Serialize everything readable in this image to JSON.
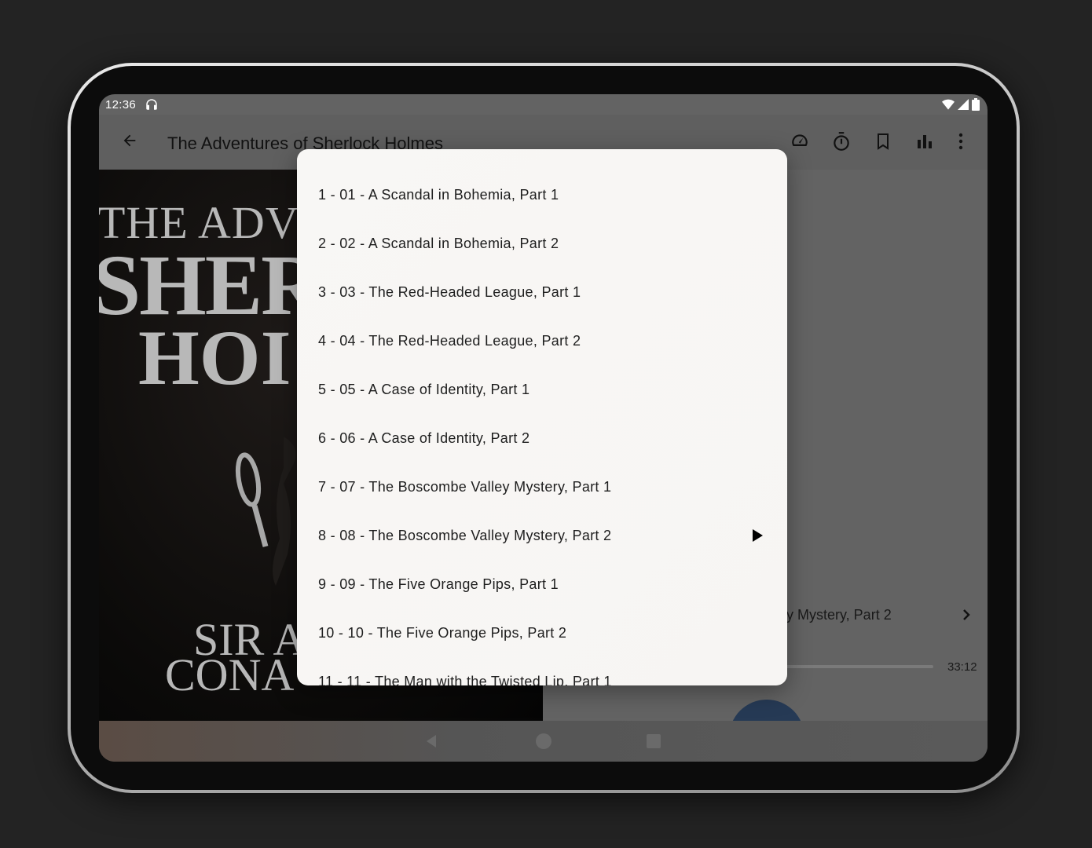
{
  "status_bar": {
    "time": "12:36",
    "left_icons": [
      "headphones-icon"
    ],
    "right_icons": [
      "wifi-icon",
      "signal-icon",
      "battery-icon"
    ]
  },
  "app_bar": {
    "title": "The Adventures of Sherlock Holmes",
    "back_icon": "arrow-back-icon",
    "actions": [
      "playback-speed-icon",
      "sleep-timer-icon",
      "bookmark-icon",
      "equalizer-icon",
      "more-options-icon"
    ]
  },
  "cover": {
    "lines": [
      "THE ADVE",
      "SHER",
      "HOI",
      "SIR A",
      "CONA"
    ]
  },
  "player": {
    "chapter_partial": "ey Mystery, Part 2",
    "total_time": "33:12"
  },
  "chapters_dialog": {
    "current_index": 7,
    "items": [
      "1 - 01 - A Scandal in Bohemia, Part 1",
      "2 - 02 - A Scandal in Bohemia, Part 2",
      "3 - 03 - The Red-Headed League, Part 1",
      "4 - 04 - The Red-Headed League, Part 2",
      "5 - 05 - A Case of Identity, Part 1",
      "6 - 06 - A Case of Identity, Part 2",
      "7 - 07 - The Boscombe Valley Mystery, Part 1",
      "8 - 08 - The Boscombe Valley Mystery, Part 2",
      "9 - 09 - The Five Orange Pips, Part 1",
      "10 - 10 - The Five Orange Pips, Part 2",
      "11 - 11 - The Man with the Twisted Lip, Part 1"
    ]
  },
  "colors": {
    "background": "#232323",
    "scrim": "#636363",
    "dialog": "#f8f7f5",
    "play_button": "#263a55"
  }
}
